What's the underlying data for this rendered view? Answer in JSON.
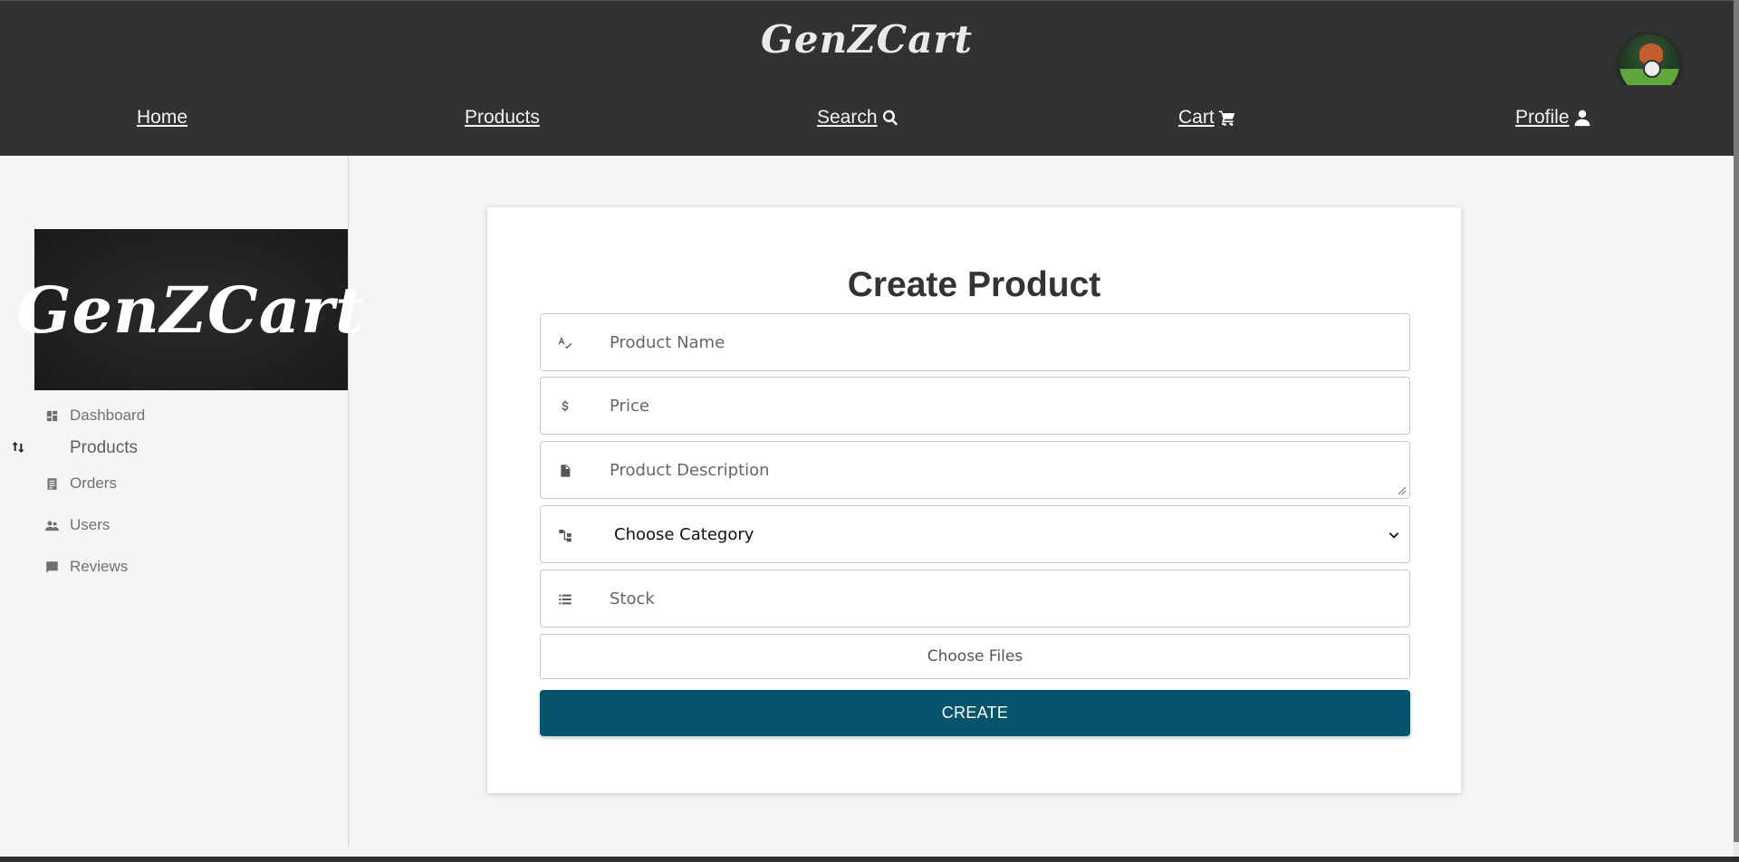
{
  "header": {
    "brand": "GenZCart",
    "nav": [
      {
        "label": "Home",
        "icon": ""
      },
      {
        "label": "Products",
        "icon": ""
      },
      {
        "label": "Search ",
        "icon": "search-icon"
      },
      {
        "label": "Cart ",
        "icon": "cart-icon"
      },
      {
        "label": "Profile ",
        "icon": "user-icon"
      }
    ]
  },
  "sidebar": {
    "logo_text": "GenZCart",
    "items": [
      {
        "label": "Dashboard",
        "icon": "dashboard-icon"
      },
      {
        "label": "Products",
        "icon": "swap-icon"
      },
      {
        "label": "Orders",
        "icon": "orders-icon"
      },
      {
        "label": "Users",
        "icon": "users-icon"
      },
      {
        "label": "Reviews",
        "icon": "reviews-icon"
      }
    ]
  },
  "form": {
    "title": "Create Product",
    "name_placeholder": "Product Name",
    "price_placeholder": "Price",
    "description_placeholder": "Product Description",
    "category_selected": "Choose Category",
    "stock_placeholder": "Stock",
    "files_label": "Choose Files",
    "submit_label": "CREATE"
  },
  "colors": {
    "header_bg": "#323232",
    "accent": "#05546b",
    "page_bg": "#f4f5f7"
  }
}
